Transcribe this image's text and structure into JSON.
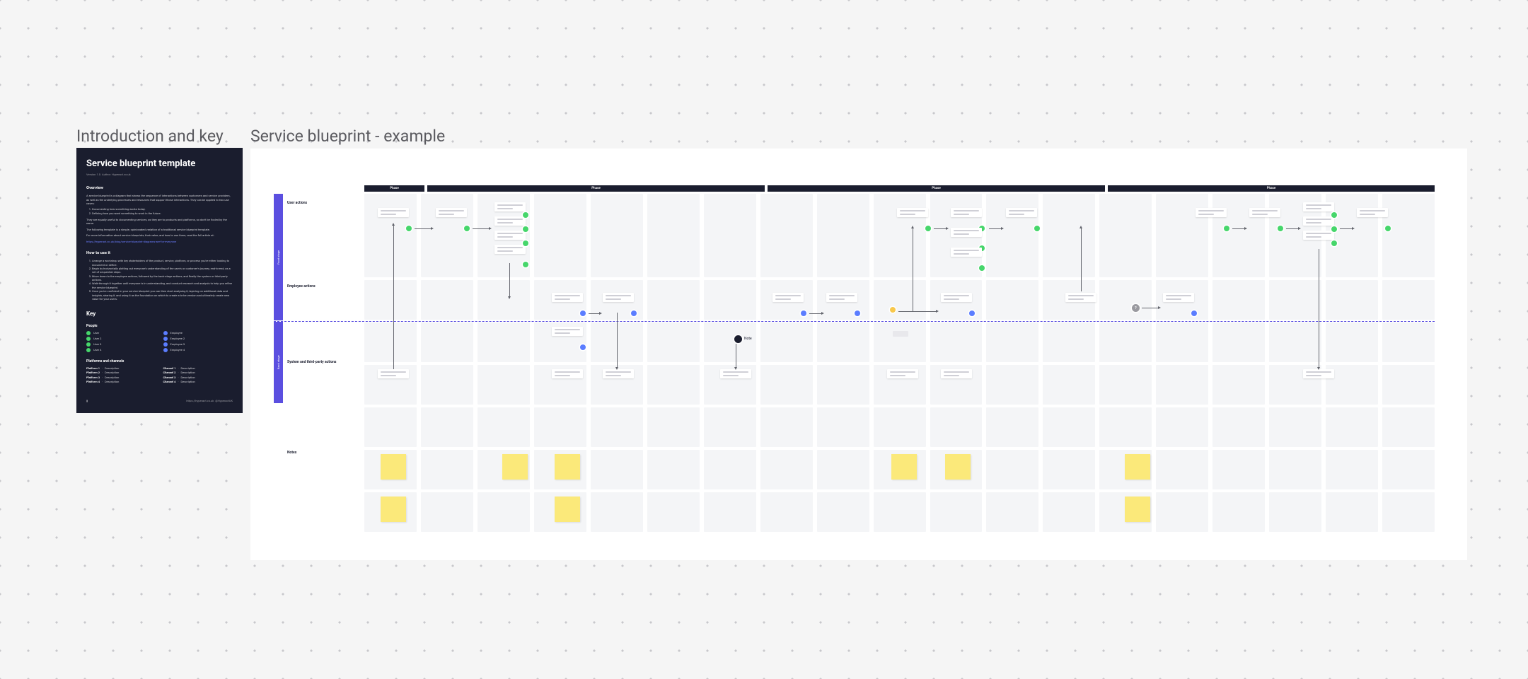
{
  "labels": {
    "intro": "Introduction and key",
    "example": "Service blueprint - example"
  },
  "intro": {
    "title": "Service blueprint template",
    "version": "Version 1.0. Author: Hyperact.co.uk",
    "overview_h": "Overview",
    "overview_p1": "A service blueprint is a diagram that shows the sequence of interactions between customers and service providers, as well as the underlying processes and resources that support those interactions. They can be applied to two use cases:",
    "ol1_1": "Documenting how something works today.",
    "ol1_2": "Defining how you want something to work in the future.",
    "overview_p2": "They are equally useful to documenting services, as they are to products and platforms, so don't be fooled by the name.",
    "overview_p3": "The following template is a simple, opinionated variation of a traditional service blueprint template.",
    "overview_p4": "For more information about service blueprints, their value, and how to use them, read the full article at:",
    "link": "https://hyperact.co.uk/blog/service-blueprint-diagrams-are-for-everyone",
    "howto_h": "How to use it",
    "howto_1": "Arrange a workshop with key stakeholders of the product, service, platform, or process you're either looking to document or define.",
    "howto_2": "Begin by horizontally plotting out everyone's understanding of the user's or customer's journey, end-to-end, as a set of sequential steps.",
    "howto_3": "Move down to the employee actions, followed by the back-stage actions, and finally the system or third-party actions.",
    "howto_4": "Walk-through it together until everyone is in understanding, and conduct research and analysis to help you refine the service blueprint.",
    "howto_5": "Once you're confident in your service blueprint you can then start analysing it, layering on additional data and insights, sharing it, and using it as the foundation on which to create a to-be version and ultimately create new value for your users.",
    "key_h": "Key",
    "people_h": "People",
    "people": [
      {
        "color": "#46d66b",
        "label": "User"
      },
      {
        "color": "#5b7dff",
        "label": "Employee"
      },
      {
        "color": "#46d66b",
        "label": "User 2"
      },
      {
        "color": "#5b7dff",
        "label": "Employee 2"
      },
      {
        "color": "#46d66b",
        "label": "User 3"
      },
      {
        "color": "#5b7dff",
        "label": "Employee 3"
      },
      {
        "color": "#46d66b",
        "label": "User 4"
      },
      {
        "color": "#5b7dff",
        "label": "Employee 4"
      }
    ],
    "pc_h": "Platforms and channels",
    "platforms": [
      {
        "k": "Platform 1",
        "v": "Description"
      },
      {
        "k": "Platform 2",
        "v": "Description"
      },
      {
        "k": "Platform 3",
        "v": "Description"
      },
      {
        "k": "Platform 4",
        "v": "Description"
      }
    ],
    "channels": [
      {
        "k": "Channel 1",
        "v": "Description"
      },
      {
        "k": "Channel 2",
        "v": "Description"
      },
      {
        "k": "Channel 3",
        "v": "Description"
      },
      {
        "k": "Channel 4",
        "v": "Description"
      }
    ],
    "footer_l": "https://hyperact.co.uk",
    "footer_r": "@HyperactUK"
  },
  "bp": {
    "phases": [
      "Phase",
      "Phase",
      "Phase",
      "Phase"
    ],
    "rows": {
      "user": "User actions",
      "employee": "Employee actions",
      "system": "System and third-party actions",
      "notes": "Notes"
    },
    "stages": {
      "front": "Front stage",
      "back": "Back stage"
    },
    "gateway": "?",
    "black_label": "Note"
  },
  "colors": {
    "green": "#46d66b",
    "blue": "#5b7dff",
    "yellow": "#f8c84c",
    "navy": "#1a1d2e",
    "purple": "#5b4fe0"
  }
}
